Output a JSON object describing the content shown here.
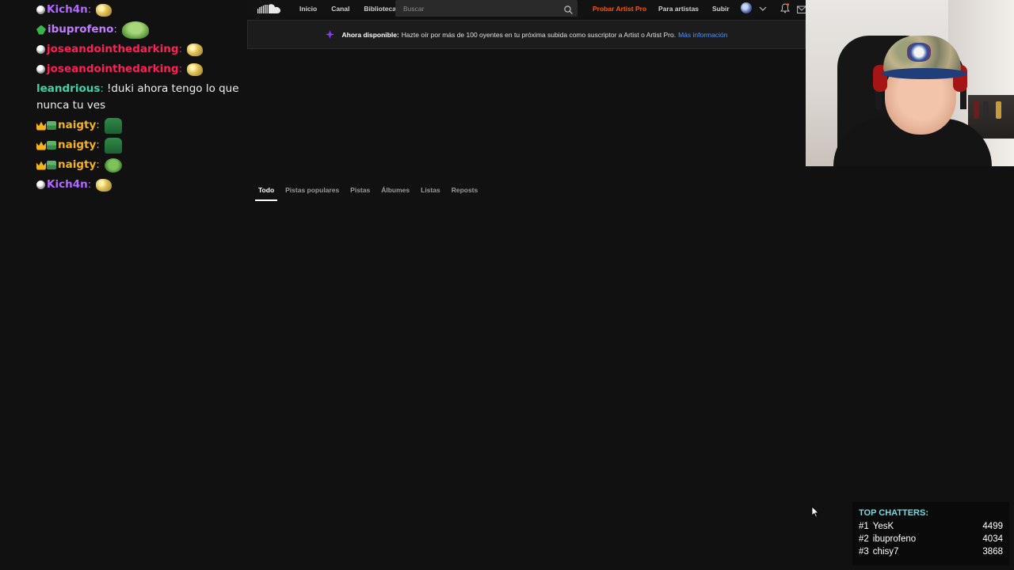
{
  "chat": {
    "messages": [
      {
        "badges": [
          "circle"
        ],
        "user": "Kich4n",
        "color": "#b169ff",
        "text": "",
        "emotes": [
          "pepe-gold"
        ]
      },
      {
        "badges": [
          "leaf"
        ],
        "user": "ibuprofeno",
        "color": "#c07dff",
        "text": "",
        "emotes": [
          "frog-wide"
        ]
      },
      {
        "badges": [
          "circle"
        ],
        "user": "joseandointhedarking",
        "color": "#ff1e55",
        "text": "",
        "emotes": [
          "pepe-gold"
        ]
      },
      {
        "badges": [
          "circle"
        ],
        "user": "joseandointhedarking",
        "color": "#ff1e55",
        "text": "",
        "emotes": [
          "pepe-gold"
        ]
      },
      {
        "badges": [],
        "user": "leandrious",
        "color": "#3fd1a8",
        "text": "!duki ahora tengo lo que nunca tu ves",
        "emotes": []
      },
      {
        "badges": [
          "crown",
          "mini"
        ],
        "user": "naigty",
        "color": "#f3b31d",
        "text": "",
        "emotes": [
          "green-block"
        ]
      },
      {
        "badges": [
          "crown",
          "mini"
        ],
        "user": "naigty",
        "color": "#f3b31d",
        "text": "",
        "emotes": [
          "green-block"
        ]
      },
      {
        "badges": [
          "crown",
          "mini"
        ],
        "user": "naigty",
        "color": "#f3b31d",
        "text": "",
        "emotes": [
          "frog-small"
        ]
      },
      {
        "badges": [
          "circle"
        ],
        "user": "Kich4n",
        "color": "#b169ff",
        "text": "",
        "emotes": [
          "pepe-gold"
        ]
      }
    ]
  },
  "soundcloud": {
    "logo_icon": "soundcloud-logo-icon",
    "nav": {
      "home": "Inicio",
      "feed": "Canal",
      "library": "Biblioteca"
    },
    "search": {
      "placeholder": "Buscar",
      "value": ""
    },
    "try_pro": "Probar Artist Pro",
    "for_artists": "Para artistas",
    "upload": "Subir",
    "banner": {
      "bold": "Ahora disponible:",
      "text": "Hazte oír por más de 100 oyentes en tu próxima subida como suscriptor a Artist o Artist Pro.",
      "link": "Más información"
    },
    "tabs": [
      {
        "label": "Todo",
        "active": true
      },
      {
        "label": "Pistas populares",
        "active": false
      },
      {
        "label": "Pistas",
        "active": false
      },
      {
        "label": "Álbumes",
        "active": false
      },
      {
        "label": "Listas",
        "active": false
      },
      {
        "label": "Reposts",
        "active": false
      }
    ],
    "colors": {
      "accent": "#ff5500",
      "link": "#4f95ff",
      "background": "#111111"
    }
  },
  "top_chatters": {
    "title": "TOP CHATTERS:",
    "rows": [
      {
        "rank": "#1",
        "name": "YesK",
        "count": "4499"
      },
      {
        "rank": "#2",
        "name": "ibuprofeno",
        "count": "4034"
      },
      {
        "rank": "#3",
        "name": "chisy7",
        "count": "3868"
      }
    ]
  }
}
